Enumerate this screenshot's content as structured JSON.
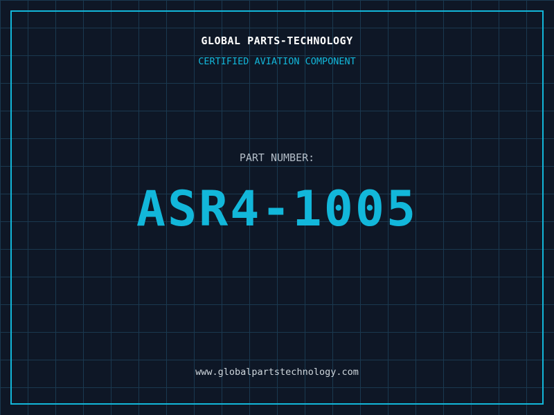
{
  "theme": {
    "bg": "#0e1726",
    "grid": "#1a3950",
    "accent": "#12b7da",
    "white": "#ffffff",
    "gray": "#b4bec8",
    "gray-light": "#ced6dc"
  },
  "header": {
    "company_name": "GLOBAL PARTS-TECHNOLOGY",
    "tagline": "CERTIFIED AVIATION COMPONENT"
  },
  "part": {
    "label": "PART NUMBER:",
    "number": "ASR4-1005"
  },
  "footer": {
    "website": "www.globalpartstechnology.com"
  }
}
